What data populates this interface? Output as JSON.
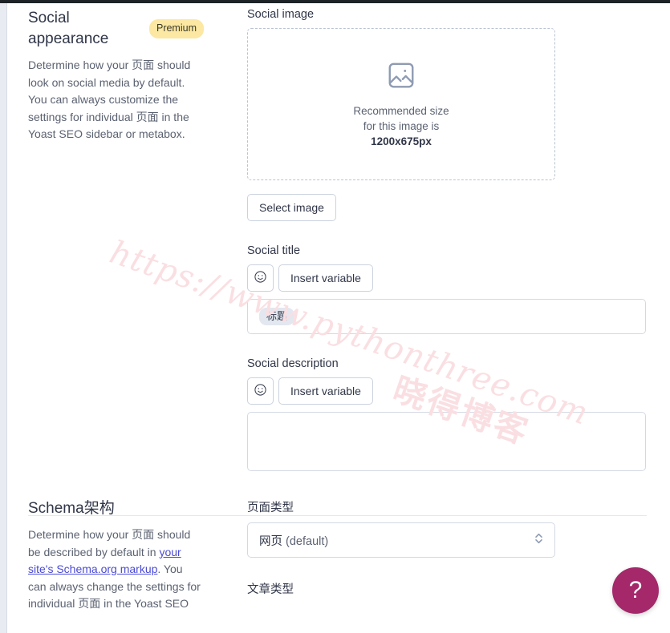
{
  "social_section": {
    "title": "Social appearance",
    "badge": "Premium",
    "description_html": "Determine how your 页面 should look on social media by default. You can always customize the settings for individual 页面 in the Yoast SEO sidebar or metabox.",
    "image_field": {
      "label": "Social image",
      "placeholder_icon": "image-placeholder-icon",
      "recommend_line1": "Recommended size",
      "recommend_line2": "for this image is",
      "recommend_size": "1200x675px",
      "select_button": "Select image"
    },
    "title_field": {
      "label": "Social title",
      "emoji_button_icon": "smiley-icon",
      "insert_variable_button": "Insert variable",
      "value_chip": "标题"
    },
    "description_field": {
      "label": "Social description",
      "emoji_button_icon": "smiley-icon",
      "insert_variable_button": "Insert variable",
      "value": ""
    }
  },
  "schema_section": {
    "title": "Schema架构",
    "desc_part1": "Determine how your 页面 should be described by default in ",
    "desc_link": "your site's Schema.org markup",
    "desc_part2": ". You can always change the settings for individual 页面 in the Yoast SEO",
    "page_type": {
      "label": "页面类型",
      "value_main": "网页",
      "value_suffix": " (default)"
    },
    "article_type": {
      "label": "文章类型"
    }
  },
  "help_fab": {
    "icon": "question-mark-icon",
    "label": "?",
    "color": "#a4286a"
  },
  "watermark": {
    "url": "https://www.pythonthree.com",
    "cn": "晓得博客"
  },
  "colors": {
    "premium_badge_bg": "#fce8a2",
    "link": "#4a4ad6",
    "text_primary": "#303648",
    "text_secondary": "#5b6271",
    "border": "#d3d9e3",
    "help_fab": "#a4286a"
  }
}
